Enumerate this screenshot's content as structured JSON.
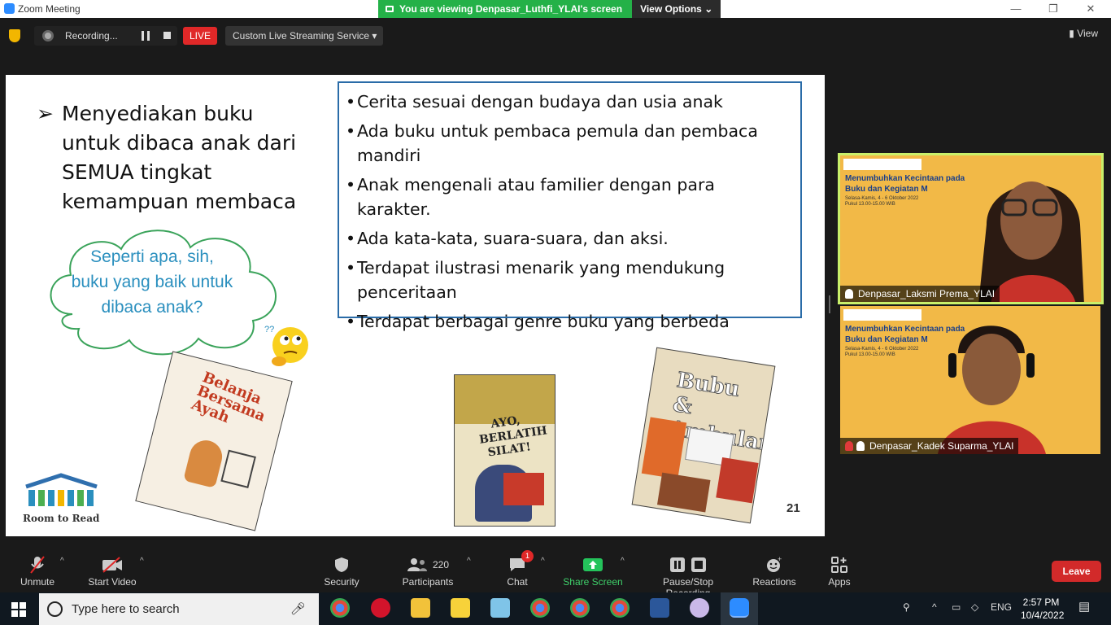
{
  "window": {
    "title": "Zoom Meeting",
    "minimize": "—",
    "restore": "❐",
    "close": "✕"
  },
  "banner": {
    "message": "You are viewing Denpasar_Luthfi_YLAI's screen",
    "view_options": "View Options ⌄"
  },
  "top_bar": {
    "recording_label": "Recording...",
    "live_label": "LIVE",
    "stream_service": "Custom Live Streaming Service ▾",
    "view_label": "View"
  },
  "slide": {
    "heading": "Menyediakan buku untuk dibaca anak dari SEMUA tingkat kemampuan membaca",
    "bullets": [
      "Cerita sesuai dengan budaya dan usia anak",
      "Ada buku untuk pembaca pemula dan pembaca mandiri",
      "Anak mengenali atau familier dengan para karakter.",
      "Ada kata-kata, suara-suara, dan aksi.",
      "Terdapat ilustrasi menarik yang mendukung penceritaan",
      "Terdapat berbagai genre buku yang berbeda"
    ],
    "cloud_text": "Seperti apa, sih, buku yang baik untuk dibaca anak?",
    "book1_title": "Belanja Bersama Ayah",
    "book2_title": "AYO, BERLATIH SILAT!",
    "book3_title": "Bubu & Ambulans",
    "logo_text": "Room to Read",
    "page_number": "21"
  },
  "participants_video": [
    {
      "name": "Denpasar_Laksmi Prema_YLAI",
      "banner_title": "Menumbuhkan Kecintaan pada Buku dan Kegiatan M",
      "banner_sub": "Selasa-Kamis, 4 - 6 Oktober 2022 Pukul 13.00-15.00 WIB"
    },
    {
      "name": "Denpasar_Kadek Suparma_YLAI",
      "banner_title": "Menumbuhkan Kecintaan pada Buku dan Kegiatan M",
      "banner_sub": "Selasa-Kamis, 4 - 6 Oktober 2022 Pukul 13.00-15.00 WIB"
    }
  ],
  "bottom_toolbar": {
    "unmute": "Unmute",
    "start_video": "Start Video",
    "security": "Security",
    "participants": "Participants",
    "participants_count": "220",
    "chat": "Chat",
    "chat_badge": "1",
    "share_screen": "Share Screen",
    "pause_recording": "Pause/Stop Recording",
    "reactions": "Reactions",
    "apps": "Apps",
    "leave": "Leave"
  },
  "taskbar": {
    "search_placeholder": "Type here to search",
    "language": "ENG",
    "time": "2:57 PM",
    "date": "10/4/2022"
  },
  "colors": {
    "banner_green": "#24b148",
    "leave_red": "#d22a2a",
    "live_red": "#e02828",
    "share_green": "#24c35b",
    "slide_box_border": "#2a6ca8",
    "cloud_text": "#2a8fbe"
  }
}
